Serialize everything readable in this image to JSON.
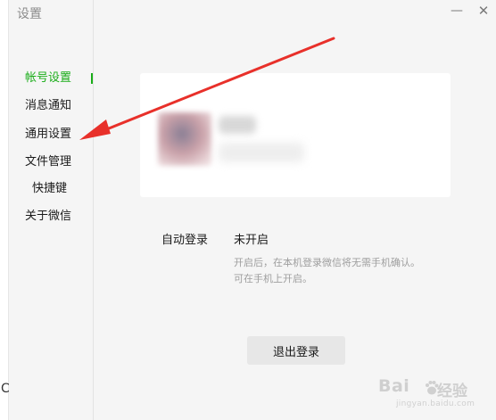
{
  "window": {
    "title": "设置",
    "minimize_icon": "minimize-icon",
    "close_icon": "close-icon",
    "minimize_glyph": "—",
    "close_glyph": "✕"
  },
  "left_edge": {
    "text": "C"
  },
  "sidebar": {
    "items": [
      {
        "label": "帐号设置",
        "active": true
      },
      {
        "label": "消息通知",
        "active": false
      },
      {
        "label": "通用设置",
        "active": false
      },
      {
        "label": "文件管理",
        "active": false
      },
      {
        "label": "快捷键",
        "active": false
      },
      {
        "label": "关于微信",
        "active": false
      }
    ],
    "active_color": "#1aad19"
  },
  "account": {
    "avatar_icon": "avatar-blurred",
    "name_icon": "name-blurred",
    "subtext_icon": "subtext-blurred"
  },
  "auto_login": {
    "label": "自动登录",
    "value": "未开启",
    "desc_line1": "开启后，在本机登录微信将无需手机确认。",
    "desc_line2": "可在手机上开启。"
  },
  "logout": {
    "label": "退出登录"
  },
  "annotation": {
    "color": "#e8302a",
    "icon": "red-arrow-annotation"
  },
  "watermark": {
    "brand_left": "Bai",
    "brand_right": "经验",
    "url": "jingyan.baidu.com",
    "icon": "baidu-paw-icon"
  }
}
